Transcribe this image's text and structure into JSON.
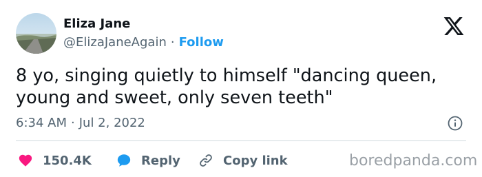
{
  "author": {
    "name": "Eliza Jane",
    "handle": "@ElizaJaneAgain",
    "separator": "·",
    "follow_label": "Follow"
  },
  "platform_icon": "x-logo-icon",
  "tweet": {
    "lines": [
      "8 yo, singing quietly to himself \"dancing queen,",
      "young and sweet, only seven teeth\""
    ],
    "time": "6:34 AM",
    "separator": "·",
    "date": "Jul 2, 2022"
  },
  "actions": {
    "like_count": "150.4K",
    "reply_label": "Reply",
    "copy_label": "Copy link"
  },
  "watermark": "boredpanda.com",
  "colors": {
    "accent": "#1d9bf0",
    "like": "#f91880",
    "text": "#0f1419",
    "muted": "#536471"
  }
}
